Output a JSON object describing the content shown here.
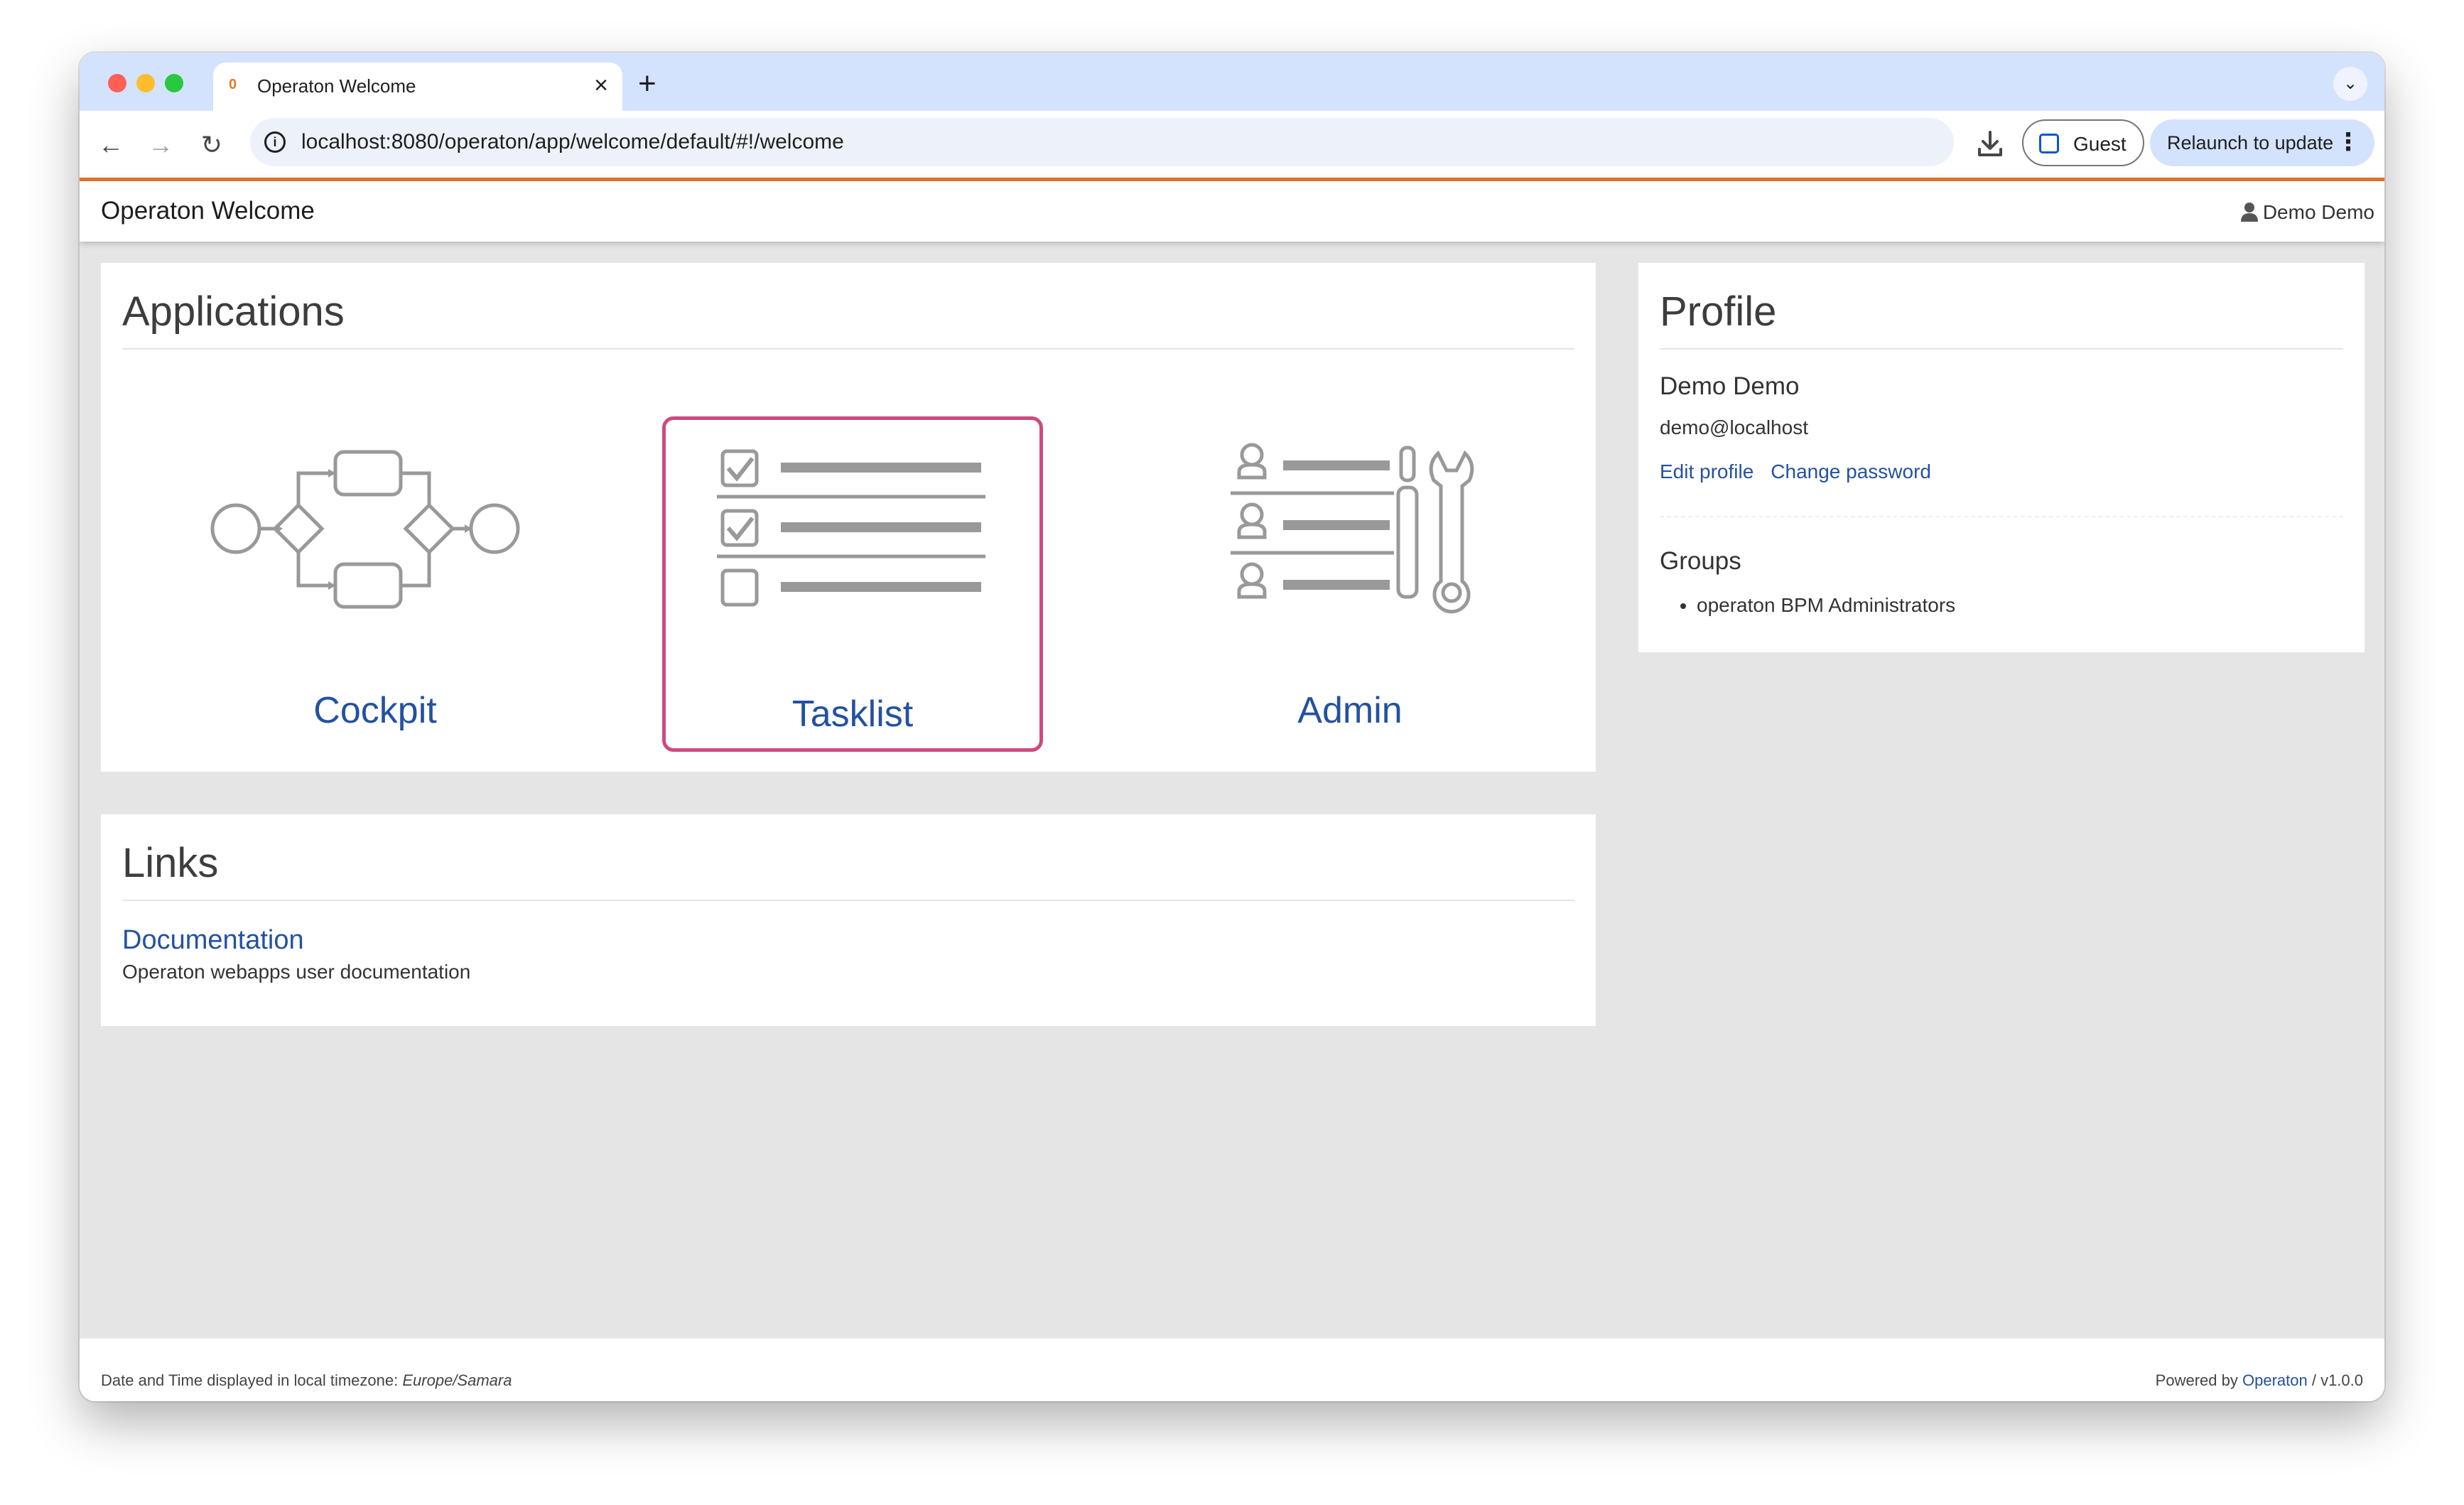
{
  "browser": {
    "tab_title": "Operaton Welcome",
    "tab_favicon": "0",
    "tab_close": "×",
    "new_tab": "+",
    "tab_menu": "⌄",
    "url": "localhost:8080/operaton/app/welcome/default/#!/welcome",
    "profile_label": "Guest",
    "relaunch_label": "Relaunch to update",
    "menu_dots": "⋮",
    "nav": {
      "back": "←",
      "forward": "→",
      "reload": "↻",
      "info": "i"
    }
  },
  "header": {
    "title": "Operaton Welcome",
    "user": "Demo Demo"
  },
  "applications": {
    "heading": "Applications",
    "items": [
      {
        "label": "Cockpit",
        "icon": "process-diagram-icon"
      },
      {
        "label": "Tasklist",
        "icon": "checklist-icon"
      },
      {
        "label": "Admin",
        "icon": "users-tools-icon"
      }
    ]
  },
  "links": {
    "heading": "Links",
    "items": [
      {
        "title": "Documentation",
        "description": "Operaton webapps user documentation"
      }
    ]
  },
  "profile": {
    "heading": "Profile",
    "name": "Demo Demo",
    "email": "demo@localhost",
    "edit_link": "Edit profile",
    "password_link": "Change password",
    "groups_heading": "Groups",
    "groups": [
      "operaton BPM Administrators"
    ]
  },
  "footer": {
    "timezone_prefix": "Date and Time displayed in local timezone:",
    "timezone": "Europe/Samara",
    "powered_prefix": "Powered by",
    "powered_link": "Operaton",
    "version": "/ v1.0.0"
  },
  "colors": {
    "accent_orange": "#e0702b",
    "link_blue": "#2451a0",
    "highlight_pink": "#cf4a7f",
    "icon_gray": "#999999"
  }
}
